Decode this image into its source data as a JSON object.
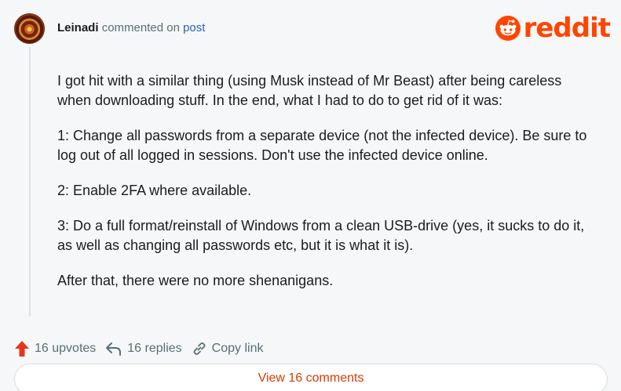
{
  "header": {
    "username": "Leinadi",
    "action_text": "commented on",
    "post_link": "post"
  },
  "logo": {
    "wordmark": "reddit",
    "icon": "reddit-snoo-icon",
    "color": "#ff4500"
  },
  "comment": {
    "paragraphs": [
      "I got hit with a similar thing (using Musk instead of Mr Beast) after being careless when downloading stuff. In the end, what I had to do to get rid of it was:",
      "1: Change all passwords from a separate device (not the infected device). Be sure to log out of all logged in sessions. Don't use the infected device online.",
      "2: Enable 2FA where available.",
      "3: Do a full format/reinstall of Windows from a clean USB-drive (yes, it sucks to do it, as well as changing all passwords etc, but it is what it is).",
      "After that, there were no more shenanigans."
    ]
  },
  "actions": {
    "upvotes_label": "16 upvotes",
    "replies_label": "16 replies",
    "copy_link_label": "Copy link",
    "upvote_color": "#e8341c"
  },
  "footer": {
    "view_comments_label": "View 16 comments",
    "accent_color": "#d93a00"
  }
}
